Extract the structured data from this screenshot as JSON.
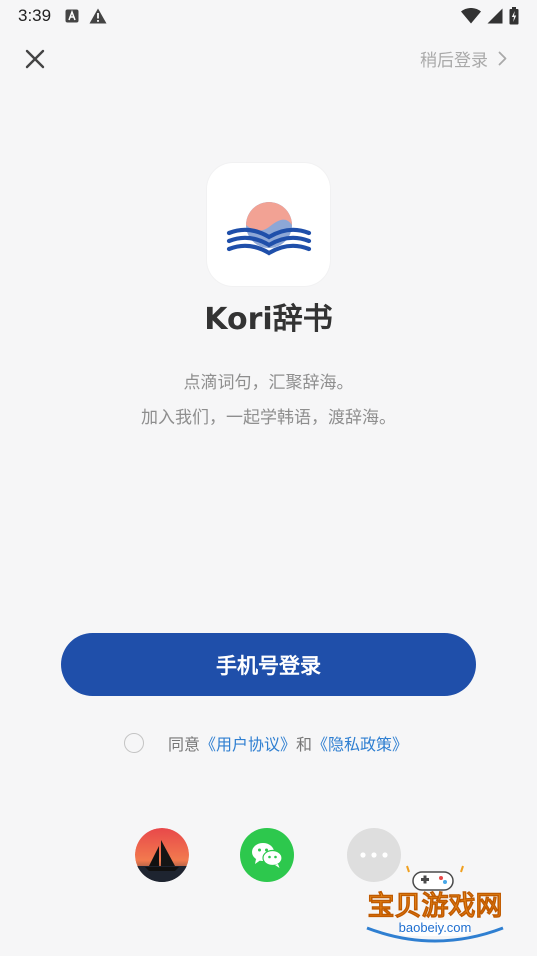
{
  "status_bar": {
    "time": "3:39",
    "left_icons": [
      "a-notification-icon",
      "warning-icon"
    ],
    "right_icons": [
      "wifi-icon",
      "cell-signal-icon",
      "battery-icon"
    ]
  },
  "top_bar": {
    "close_icon": "close-icon",
    "later_login_label": "稍后登录",
    "later_login_icon": "chevron-right-icon"
  },
  "app": {
    "name": "Kori辞书",
    "tagline_1": "点滴词句，汇聚辞海。",
    "tagline_2": "加入我们，一起学韩语，渡辞海。",
    "logo_colors": {
      "sun_top": "#f2a294",
      "sun_bottom": "#8da7d6",
      "book": "#1f4faa"
    }
  },
  "login": {
    "phone_login_label": "手机号登录"
  },
  "agreement": {
    "prefix": "同意",
    "user_agreement": "《用户协议》",
    "and": "和",
    "privacy_policy": "《隐私政策》",
    "checked": false
  },
  "social_login": [
    {
      "name": "kori",
      "icon": "sailboat-sunset-icon"
    },
    {
      "name": "wechat",
      "icon": "wechat-icon",
      "color": "#2dc84d"
    },
    {
      "name": "more",
      "icon": "more-dots-icon"
    }
  ],
  "watermark": {
    "title": "宝贝游戏网",
    "url": "baobeiy.com"
  },
  "colors": {
    "background": "#f6f6f7",
    "primary": "#1f4faa",
    "link": "#2f7fd1",
    "muted": "#a9a9a9"
  }
}
